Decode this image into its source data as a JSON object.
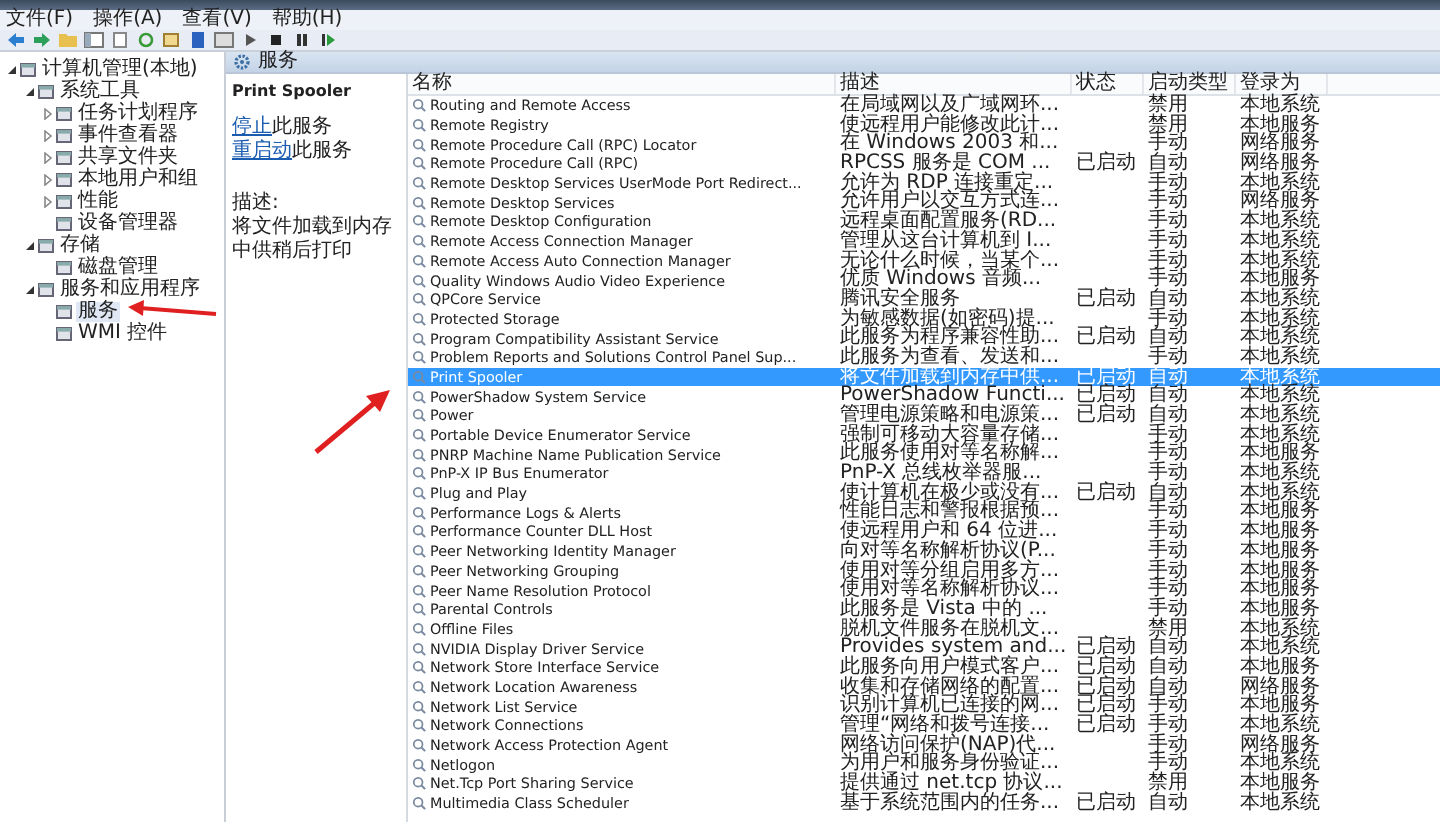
{
  "menu": [
    "文件(F)",
    "操作(A)",
    "查看(V)",
    "帮助(H)"
  ],
  "tree": [
    {
      "label": "计算机管理(本地)",
      "expanded": true,
      "selected": false,
      "children": [
        {
          "label": "系统工具",
          "expanded": true,
          "selected": false,
          "children": [
            {
              "label": "任务计划程序",
              "expanded": false,
              "selected": false
            },
            {
              "label": "事件查看器",
              "expanded": false,
              "selected": false
            },
            {
              "label": "共享文件夹",
              "expanded": false,
              "selected": false
            },
            {
              "label": "本地用户和组",
              "expanded": false,
              "selected": false
            },
            {
              "label": "性能",
              "expanded": false,
              "selected": false
            },
            {
              "label": "设备管理器",
              "selected": false
            }
          ]
        },
        {
          "label": "存储",
          "expanded": true,
          "selected": false,
          "children": [
            {
              "label": "磁盘管理",
              "selected": false
            }
          ]
        },
        {
          "label": "服务和应用程序",
          "expanded": true,
          "selected": false,
          "children": [
            {
              "label": "服务",
              "selected": true
            },
            {
              "label": "WMI 控件",
              "selected": false
            }
          ]
        }
      ]
    }
  ],
  "panel_header": "服务",
  "detail": {
    "title": "Print Spooler",
    "actions": [
      {
        "link": "停止",
        "text": "此服务"
      },
      {
        "link": "重启动",
        "text": "此服务"
      }
    ],
    "description_label": "描述:",
    "description": "将文件加载到内存中供稍后打印"
  },
  "table": {
    "columns": [
      "名称",
      "描述",
      "状态",
      "启动类型",
      "登录为"
    ],
    "rows": [
      {
        "name": "Routing and Remote Access",
        "description": "在局域网以及广域网环...",
        "startup": "禁用",
        "logon": "本地系统",
        "selected": false
      },
      {
        "name": "Remote Registry",
        "description": "使远程用户能修改此计...",
        "startup": "禁用",
        "logon": "本地服务",
        "selected": false
      },
      {
        "name": "Remote Procedure Call (RPC) Locator",
        "description": "在 Windows 2003 和...",
        "startup": "手动",
        "logon": "网络服务",
        "selected": false
      },
      {
        "name": "Remote Procedure Call (RPC)",
        "description": "RPCSS 服务是 COM ...",
        "status": "已启动",
        "startup": "自动",
        "logon": "网络服务",
        "selected": false
      },
      {
        "name": "Remote Desktop Services UserMode Port Redirect...",
        "description": "允许为 RDP 连接重定...",
        "startup": "手动",
        "logon": "本地系统",
        "selected": false
      },
      {
        "name": "Remote Desktop Services",
        "description": "允许用户以交互方式连...",
        "startup": "手动",
        "logon": "网络服务",
        "selected": false
      },
      {
        "name": "Remote Desktop Configuration",
        "description": "远程桌面配置服务(RD...",
        "startup": "手动",
        "logon": "本地系统",
        "selected": false
      },
      {
        "name": "Remote Access Connection Manager",
        "description": "管理从这台计算机到 I...",
        "startup": "手动",
        "logon": "本地系统",
        "selected": false
      },
      {
        "name": "Remote Access Auto Connection Manager",
        "description": "无论什么时候，当某个...",
        "startup": "手动",
        "logon": "本地系统",
        "selected": false
      },
      {
        "name": "Quality Windows Audio Video Experience",
        "description": "优质 Windows 音频...",
        "startup": "手动",
        "logon": "本地服务",
        "selected": false
      },
      {
        "name": "QPCore Service",
        "description": "腾讯安全服务",
        "status": "已启动",
        "startup": "自动",
        "logon": "本地系统",
        "selected": false
      },
      {
        "name": "Protected Storage",
        "description": "为敏感数据(如密码)提...",
        "startup": "手动",
        "logon": "本地系统",
        "selected": false
      },
      {
        "name": "Program Compatibility Assistant Service",
        "description": "此服务为程序兼容性助...",
        "status": "已启动",
        "startup": "自动",
        "logon": "本地系统",
        "selected": false
      },
      {
        "name": "Problem Reports and Solutions Control Panel Sup...",
        "description": "此服务为查看、发送和...",
        "startup": "手动",
        "logon": "本地系统",
        "selected": false
      },
      {
        "name": "Print Spooler",
        "description": "将文件加载到内存中供...",
        "status": "已启动",
        "startup": "自动",
        "logon": "本地系统",
        "selected": true
      },
      {
        "name": "PowerShadow System Service",
        "description": "PowerShadow Functi...",
        "status": "已启动",
        "startup": "自动",
        "logon": "本地系统",
        "selected": false
      },
      {
        "name": "Power",
        "description": "管理电源策略和电源策...",
        "status": "已启动",
        "startup": "自动",
        "logon": "本地系统",
        "selected": false
      },
      {
        "name": "Portable Device Enumerator Service",
        "description": "强制可移动大容量存储...",
        "startup": "手动",
        "logon": "本地系统",
        "selected": false
      },
      {
        "name": "PNRP Machine Name Publication Service",
        "description": "此服务使用对等名称解...",
        "startup": "手动",
        "logon": "本地服务",
        "selected": false
      },
      {
        "name": "PnP-X IP Bus Enumerator",
        "description": "PnP-X 总线枚举器服...",
        "startup": "手动",
        "logon": "本地系统",
        "selected": false
      },
      {
        "name": "Plug and Play",
        "description": "使计算机在极少或没有...",
        "status": "已启动",
        "startup": "自动",
        "logon": "本地系统",
        "selected": false
      },
      {
        "name": "Performance Logs & Alerts",
        "description": "性能日志和警报根据预...",
        "startup": "手动",
        "logon": "本地服务",
        "selected": false
      },
      {
        "name": "Performance Counter DLL Host",
        "description": "使远程用户和 64 位进...",
        "startup": "手动",
        "logon": "本地服务",
        "selected": false
      },
      {
        "name": "Peer Networking Identity Manager",
        "description": "向对等名称解析协议(P...",
        "startup": "手动",
        "logon": "本地服务",
        "selected": false
      },
      {
        "name": "Peer Networking Grouping",
        "description": "使用对等分组启用多方...",
        "startup": "手动",
        "logon": "本地服务",
        "selected": false
      },
      {
        "name": "Peer Name Resolution Protocol",
        "description": "使用对等名称解析协议...",
        "startup": "手动",
        "logon": "本地服务",
        "selected": false
      },
      {
        "name": "Parental Controls",
        "description": "此服务是 Vista 中的 ...",
        "startup": "手动",
        "logon": "本地服务",
        "selected": false
      },
      {
        "name": "Offline Files",
        "description": "脱机文件服务在脱机文...",
        "startup": "禁用",
        "logon": "本地系统",
        "selected": false
      },
      {
        "name": "NVIDIA Display Driver Service",
        "description": "Provides system and...",
        "status": "已启动",
        "startup": "自动",
        "logon": "本地系统",
        "selected": false
      },
      {
        "name": "Network Store Interface Service",
        "description": "此服务向用户模式客户...",
        "status": "已启动",
        "startup": "自动",
        "logon": "本地服务",
        "selected": false
      },
      {
        "name": "Network Location Awareness",
        "description": "收集和存储网络的配置...",
        "status": "已启动",
        "startup": "自动",
        "logon": "网络服务",
        "selected": false
      },
      {
        "name": "Network List Service",
        "description": "识别计算机已连接的网...",
        "status": "已启动",
        "startup": "手动",
        "logon": "本地服务",
        "selected": false
      },
      {
        "name": "Network Connections",
        "description": "管理“网络和拨号连接...",
        "status": "已启动",
        "startup": "手动",
        "logon": "本地系统",
        "selected": false
      },
      {
        "name": "Network Access Protection Agent",
        "description": "网络访问保护(NAP)代...",
        "startup": "手动",
        "logon": "网络服务",
        "selected": false
      },
      {
        "name": "Netlogon",
        "description": "为用户和服务身份验证...",
        "startup": "手动",
        "logon": "本地系统",
        "selected": false
      },
      {
        "name": "Net.Tcp Port Sharing Service",
        "description": "提供通过 net.tcp 协议...",
        "startup": "禁用",
        "logon": "本地服务",
        "selected": false
      },
      {
        "name": "Multimedia Class Scheduler",
        "description": "基于系统范围内的任务...",
        "status": "已启动",
        "startup": "自动",
        "logon": "本地系统",
        "selected": false
      }
    ]
  }
}
